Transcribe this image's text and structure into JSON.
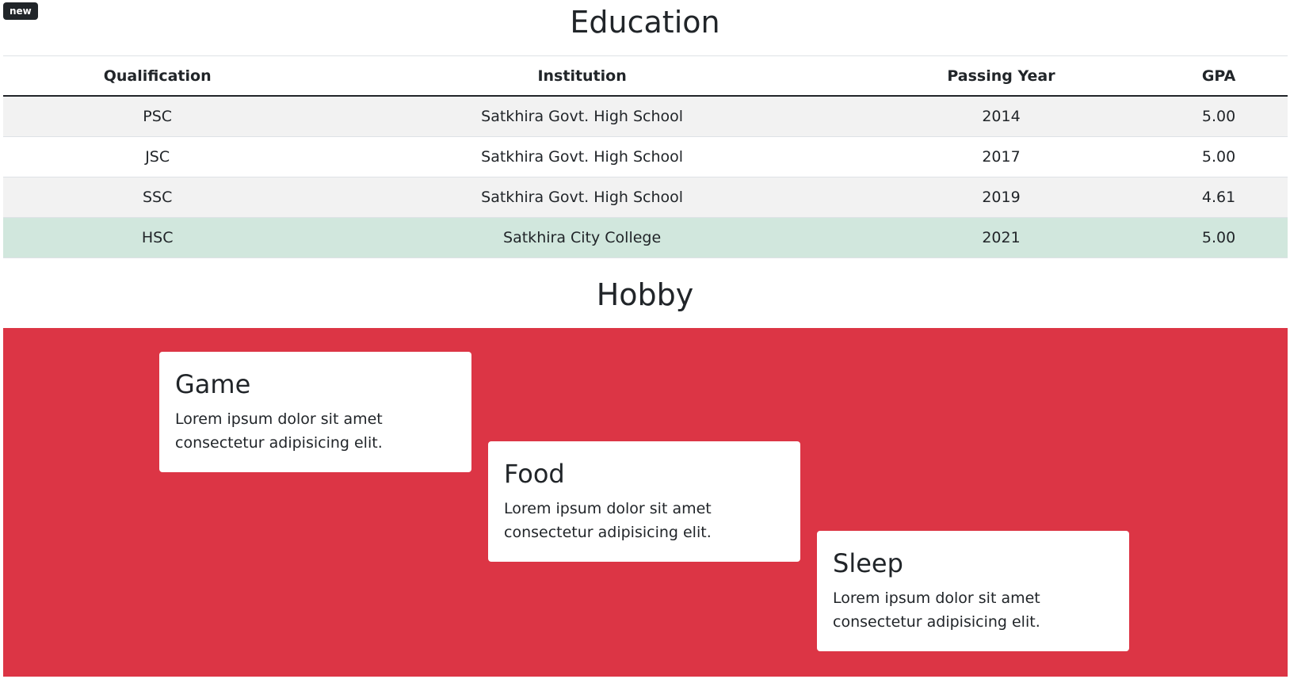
{
  "badge": {
    "label": "new"
  },
  "education": {
    "title": "Education",
    "columns": [
      "Qualification",
      "Institution",
      "Passing Year",
      "GPA"
    ],
    "rows": [
      {
        "qualification": "PSC",
        "institution": "Satkhira Govt. High School",
        "year": "2014",
        "gpa": "5.00"
      },
      {
        "qualification": "JSC",
        "institution": "Satkhira Govt. High School",
        "year": "2017",
        "gpa": "5.00"
      },
      {
        "qualification": "SSC",
        "institution": "Satkhira Govt. High School",
        "year": "2019",
        "gpa": "4.61"
      },
      {
        "qualification": "HSC",
        "institution": "Satkhira City College",
        "year": "2021",
        "gpa": "5.00"
      }
    ]
  },
  "hobby": {
    "title": "Hobby",
    "band_color": "#dc3545",
    "cards": [
      {
        "title": "Game",
        "text": "Lorem ipsum dolor sit amet consectetur adipisicing elit."
      },
      {
        "title": "Food",
        "text": "Lorem ipsum dolor sit amet consectetur adipisicing elit."
      },
      {
        "title": "Sleep",
        "text": "Lorem ipsum dolor sit amet consectetur adipisicing elit."
      }
    ]
  },
  "colors": {
    "striped_row": "#f2f2f2",
    "highlight_row": "#d1e7dd",
    "text": "#212529"
  }
}
